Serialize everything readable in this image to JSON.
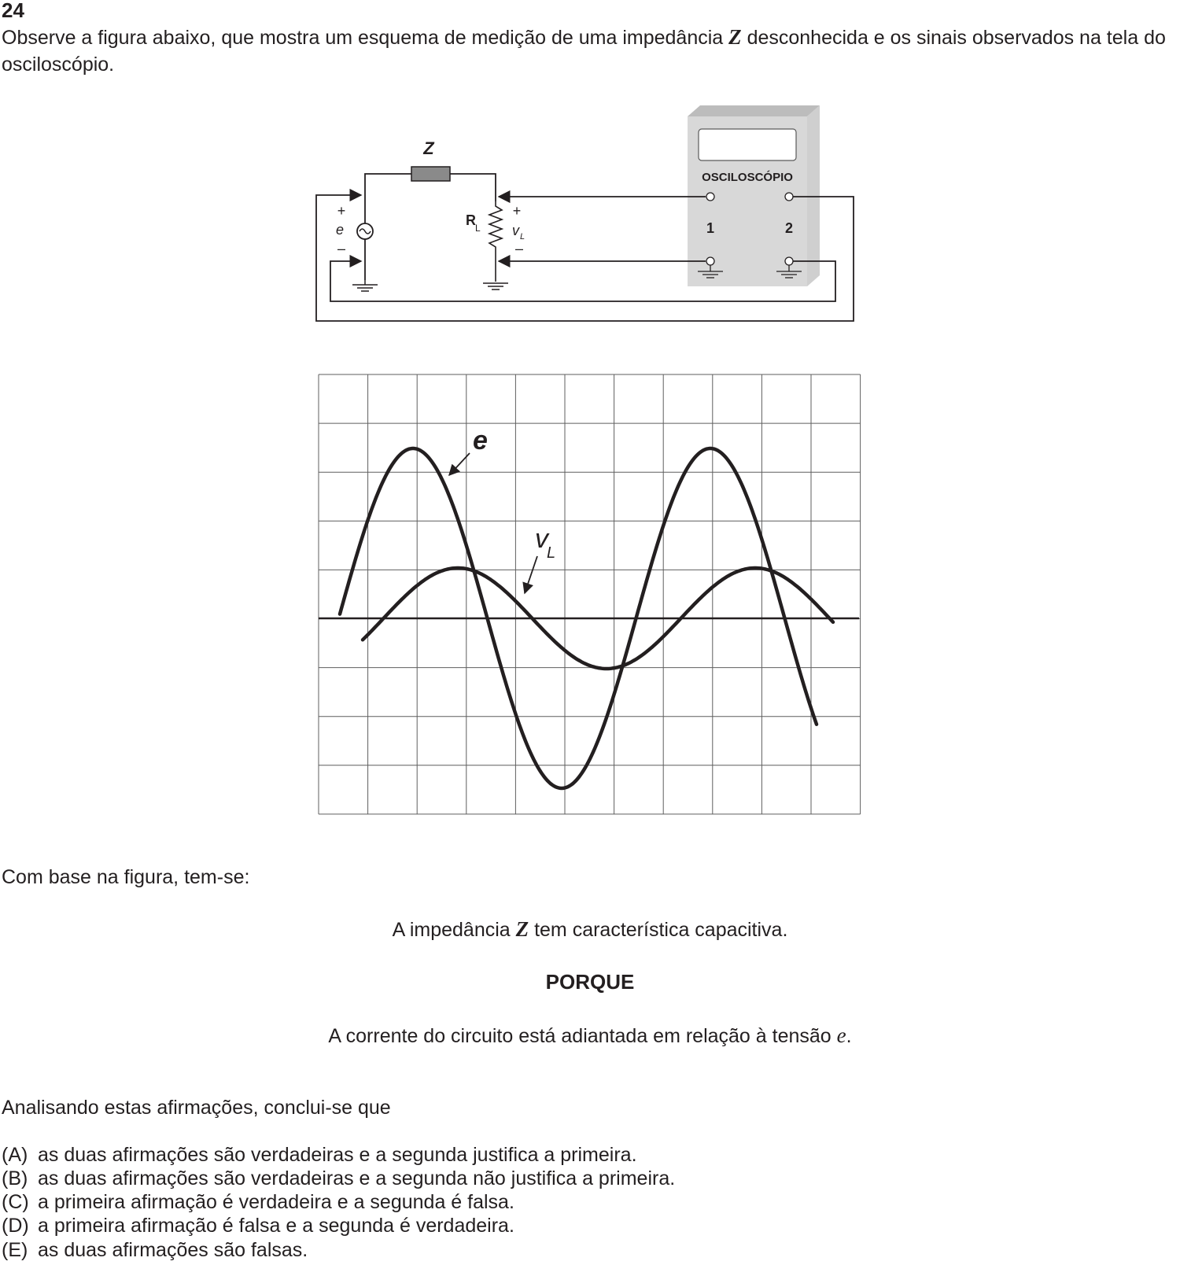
{
  "question": {
    "number": "24",
    "stem_part1": "Observe a figura abaixo, que mostra um esquema de medição de uma impedância ",
    "stem_symbol": "Z",
    "stem_part2": " desconhecida e os sinais observados na tela do osciloscópio."
  },
  "circuit": {
    "impedance_label": "Z",
    "resistor_label": "R",
    "resistor_sub": "L",
    "source_label": "e",
    "voltage_label": "v",
    "voltage_sub": "L",
    "plus": "+",
    "minus": "–",
    "oscilloscope_label": "OSCILOSCÓPIO",
    "channel_1": "1",
    "channel_2": "2"
  },
  "scope": {
    "label_e": "e",
    "label_vl": "v",
    "label_vl_sub": "L"
  },
  "body": {
    "intro": "Com base na figura, tem-se:",
    "assertion_part1": "A impedância ",
    "assertion_symbol": "Z",
    "assertion_part2": "  tem característica capacitiva.",
    "connector": "PORQUE",
    "reason_part1": "A corrente do circuito está adiantada em relação à tensão ",
    "reason_symbol": "e",
    "reason_part2": ".",
    "prompt": "Analisando estas afirmações, conclui-se que"
  },
  "options": [
    {
      "letter": "(A)",
      "text": "as duas afirmações são verdadeiras e a segunda justifica a primeira."
    },
    {
      "letter": "(B)",
      "text": "as duas afirmações são verdadeiras e a segunda não justifica a primeira."
    },
    {
      "letter": "(C)",
      "text": "a primeira afirmação é verdadeira e a segunda é falsa."
    },
    {
      "letter": "(D)",
      "text": "a primeira afirmação é falsa e a segunda é verdadeira."
    },
    {
      "letter": "(E)",
      "text": "as duas afirmações são falsas."
    }
  ]
}
